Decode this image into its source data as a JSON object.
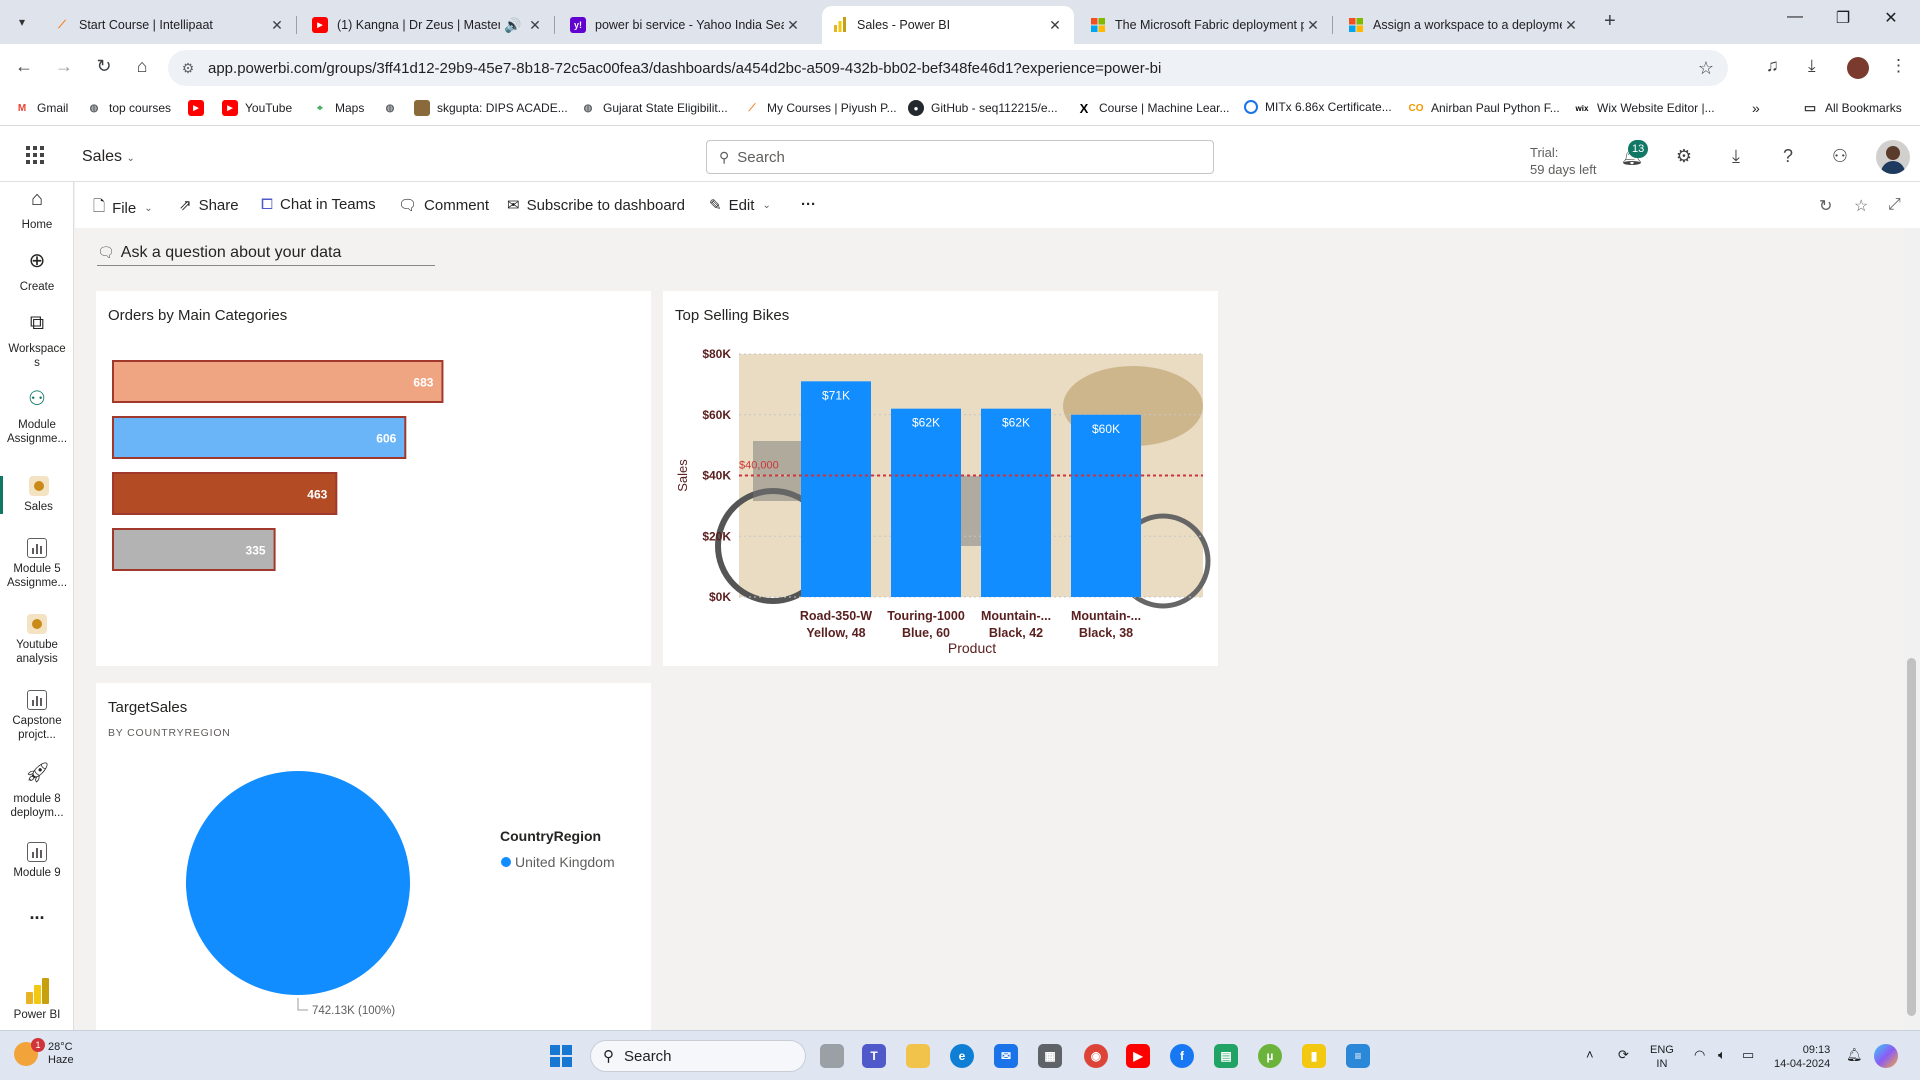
{
  "browser": {
    "tabs": [
      {
        "title": "Start Course | Intellipaat",
        "icon": "intellipaat-icon"
      },
      {
        "title": "(1) Kangna | Dr Zeus | Master",
        "icon": "youtube-icon"
      },
      {
        "title": "power bi service - Yahoo India Sea",
        "icon": "yahoo-icon"
      },
      {
        "title": "Sales - Power BI",
        "icon": "powerbi-icon",
        "active": true
      },
      {
        "title": "The Microsoft Fabric deployment p",
        "icon": "microsoft-icon"
      },
      {
        "title": "Assign a workspace to a deployme",
        "icon": "microsoft-icon"
      }
    ],
    "url": "app.powerbi.com/groups/3ff41d12-29b9-45e7-8b18-72c5ac00fea3/dashboards/a454d2bc-a509-432b-bb02-bef348fe46d1?experience=power-bi",
    "bookmarks": [
      "Gmail",
      "top courses",
      "",
      "YouTube",
      "Maps",
      "",
      "skgupta: DIPS ACADE...",
      "Gujarat State Eligibilit...",
      "My Courses | Piyush P...",
      "GitHub - seq112215/e...",
      "Course | Machine Lear...",
      "MITx 6.86x Certificate...",
      "Anirban Paul Python F...",
      "Wix Website Editor |..."
    ],
    "all_bookmarks": "All Bookmarks"
  },
  "header": {
    "workspace": "Sales",
    "search_placeholder": "Search",
    "trial_line1": "Trial:",
    "trial_line2": "59 days left",
    "notification_count": "13"
  },
  "nav": {
    "items": [
      {
        "label": "Home"
      },
      {
        "label": "Create"
      },
      {
        "label": "Workspace s"
      },
      {
        "label": "Module Assignme..."
      },
      {
        "label": "Sales"
      },
      {
        "label": "Module 5 Assignme..."
      },
      {
        "label": "Youtube analysis"
      },
      {
        "label": "Capstone projct..."
      },
      {
        "label": "module 8 deploym..."
      },
      {
        "label": "Module 9"
      },
      {
        "label": "..."
      }
    ],
    "footer": "Power BI"
  },
  "toolbar": {
    "file": "File",
    "share": "Share",
    "chat": "Chat in Teams",
    "comment": "Comment",
    "subscribe": "Subscribe to dashboard",
    "edit": "Edit",
    "more": "···"
  },
  "qna": {
    "placeholder": "Ask a question about your data"
  },
  "tiles": {
    "orders": {
      "title": "Orders by Main Categories"
    },
    "bikes": {
      "title": "Top Selling Bikes"
    },
    "target": {
      "title": "TargetSales",
      "subtitle": "BY COUNTRYREGION"
    }
  },
  "chart_data": [
    {
      "type": "bar",
      "orientation": "horizontal",
      "title": "Orders by Main Categories",
      "categories": [
        "",
        "",
        "",
        ""
      ],
      "values": [
        683,
        606,
        463,
        335
      ],
      "colors": [
        "#f0a582",
        "#6ab4f8",
        "#b34c25",
        "#b3b3b3"
      ],
      "border_color": "#a0392b"
    },
    {
      "type": "bar",
      "title": "Top Selling Bikes",
      "categories": [
        "Road-350-W Yellow, 48",
        "Touring-1000 Blue, 60",
        "Mountain-... Black, 42",
        "Mountain-... Black, 38"
      ],
      "category_lines": [
        [
          "Road-350-W",
          "Yellow, 48"
        ],
        [
          "Touring-1000",
          "Blue, 60"
        ],
        [
          "Mountain-...",
          "Black, 42"
        ],
        [
          "Mountain-...",
          "Black, 38"
        ]
      ],
      "values": [
        71000,
        62000,
        62000,
        60000
      ],
      "data_labels": [
        "$71K",
        "$62K",
        "$62K",
        "$60K"
      ],
      "xlabel": "Product",
      "ylabel": "Sales",
      "ylim": [
        0,
        80000
      ],
      "yticks": [
        0,
        20000,
        40000,
        60000,
        80000
      ],
      "ytick_labels": [
        "$0K",
        "$20K",
        "$40K",
        "$60K",
        "$80K"
      ],
      "reference_line": {
        "value": 40000,
        "label": "$40,000",
        "color": "#d13438"
      },
      "bar_color": "#118dff",
      "grid": true
    },
    {
      "type": "pie",
      "title": "TargetSales",
      "subtitle": "BY COUNTRYREGION",
      "legend_title": "CountryRegion",
      "legend_position": "right",
      "slices": [
        {
          "name": "United Kingdom",
          "value": 742130,
          "label": "742.13K (100%)",
          "color": "#118dff"
        }
      ]
    }
  ],
  "taskbar": {
    "temperature": "28°C",
    "weather": "Haze",
    "weather_badge": "1",
    "search": "Search",
    "lang1": "ENG",
    "lang2": "IN",
    "time": "09:13",
    "date": "14-04-2024"
  }
}
